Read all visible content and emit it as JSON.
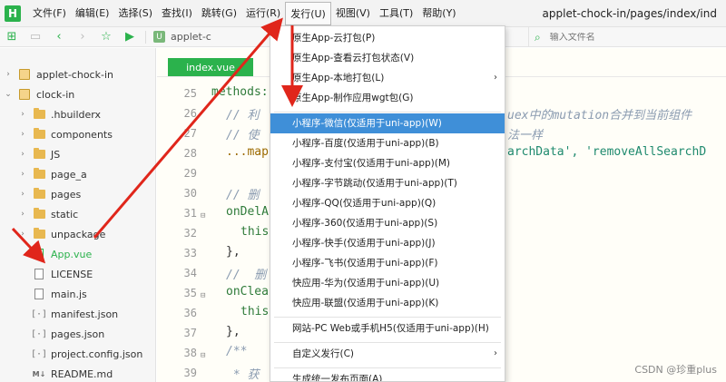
{
  "menubar": {
    "logo": "H",
    "items": [
      "文件(F)",
      "编辑(E)",
      "选择(S)",
      "查找(I)",
      "跳转(G)",
      "运行(R)",
      "发行(U)",
      "视图(V)",
      "工具(T)",
      "帮助(Y)"
    ],
    "active_index": 6,
    "title_path": "applet-chock-in/pages/index/ind"
  },
  "toolbar": {
    "breadcrumb": "applet-c",
    "file_search_placeholder": "输入文件名"
  },
  "sidebar": {
    "items": [
      {
        "label": "applet-chock-in",
        "type": "project",
        "expanded": false
      },
      {
        "label": "clock-in",
        "type": "project",
        "expanded": true
      },
      {
        "label": ".hbuilderx",
        "type": "folder"
      },
      {
        "label": "components",
        "type": "folder"
      },
      {
        "label": "JS",
        "type": "folder"
      },
      {
        "label": "page_a",
        "type": "folder"
      },
      {
        "label": "pages",
        "type": "folder"
      },
      {
        "label": "static",
        "type": "folder"
      },
      {
        "label": "unpackage",
        "type": "folder"
      },
      {
        "label": "App.vue",
        "type": "vue"
      },
      {
        "label": "LICENSE",
        "type": "file"
      },
      {
        "label": "main.js",
        "type": "file"
      },
      {
        "label": "manifest.json",
        "type": "json"
      },
      {
        "label": "pages.json",
        "type": "json"
      },
      {
        "label": "project.config.json",
        "type": "json"
      },
      {
        "label": "README.md",
        "type": "md"
      }
    ]
  },
  "editor": {
    "tab": "index.vue",
    "line_numbers": [
      "25",
      "26",
      "27",
      "28",
      "29",
      "30",
      "31",
      "32",
      "33",
      "34",
      "35",
      "36",
      "37",
      "38",
      "39"
    ],
    "code": {
      "l25": "methods:",
      "l26": "// 利",
      "l26b": "uex中的mutation合并到当前组件",
      "l27": "// 使",
      "l27b": "法一样",
      "l28": "...map",
      "l28b": "archData', 'removeAllSearchD",
      "l30": "// 删",
      "l31": "onDelA",
      "l32": "this",
      "l33": "},",
      "l34": "//  删",
      "l35": "onClea",
      "l36": "this",
      "l37": "},",
      "l38": "/**",
      "l39": " * 获"
    }
  },
  "dropdown": {
    "items": [
      "原生App-云打包(P)",
      "原生App-查看云打包状态(V)",
      "原生App-本地打包(L)",
      "原生App-制作应用wgt包(G)",
      "小程序-微信(仅适用于uni-app)(W)",
      "小程序-百度(仅适用于uni-app)(B)",
      "小程序-支付宝(仅适用于uni-app)(M)",
      "小程序-字节跳动(仅适用于uni-app)(T)",
      "小程序-QQ(仅适用于uni-app)(Q)",
      "小程序-360(仅适用于uni-app)(S)",
      "小程序-快手(仅适用于uni-app)(J)",
      "小程序-飞书(仅适用于uni-app)(F)",
      "快应用-华为(仅适用于uni-app)(U)",
      "快应用-联盟(仅适用于uni-app)(K)",
      "网站-PC Web或手机H5(仅适用于uni-app)(H)",
      "自定义发行(C)",
      "生成统一发布页面(A)"
    ],
    "highlight_index": 4,
    "submenu_indices": [
      2,
      15
    ]
  },
  "watermark": "CSDN @珍重plus",
  "colors": {
    "brand_green": "#2bb24c",
    "highlight_blue": "#3f8fd8",
    "annotation_red": "#e0261b"
  }
}
